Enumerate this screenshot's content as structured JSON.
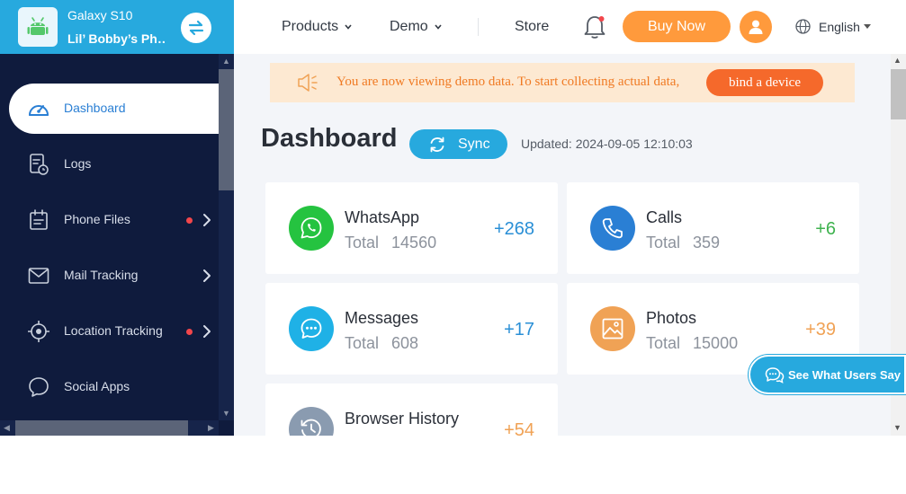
{
  "device": {
    "model": "Galaxy S10",
    "name": "Lil’ Bobby’s Ph…"
  },
  "sidebar": {
    "items": [
      {
        "label": "Dashboard",
        "icon": "dashboard-gauge-icon",
        "active": true,
        "dot": false,
        "chevron": false
      },
      {
        "label": "Logs",
        "icon": "logs-clock-icon",
        "active": false,
        "dot": false,
        "chevron": false
      },
      {
        "label": "Phone Files",
        "icon": "phone-files-calendar-icon",
        "active": false,
        "dot": true,
        "chevron": true
      },
      {
        "label": "Mail Tracking",
        "icon": "mail-envelope-icon",
        "active": false,
        "dot": false,
        "chevron": true
      },
      {
        "label": "Location Tracking",
        "icon": "location-crosshair-icon",
        "active": false,
        "dot": true,
        "chevron": true
      },
      {
        "label": "Social Apps",
        "icon": "social-chat-bubble-icon",
        "active": false,
        "dot": false,
        "chevron": false
      }
    ]
  },
  "topbar": {
    "products_label": "Products",
    "demo_label": "Demo",
    "store_label": "Store",
    "buy_label": "Buy Now",
    "language_label": "English"
  },
  "banner": {
    "text": "You are now viewing demo data. To start collecting actual data,",
    "button_label": "bind a device"
  },
  "main": {
    "title": "Dashboard",
    "sync_label": "Sync",
    "updated_text": "Updated: 2024-09-05 12:10:03",
    "total_label": "Total"
  },
  "cards": [
    {
      "title": "WhatsApp",
      "total": "14560",
      "delta": "+268",
      "icon": "whatsapp-icon",
      "icon_bg": "#25c340",
      "delta_color": "#2a8fd6"
    },
    {
      "title": "Calls",
      "total": "359",
      "delta": "+6",
      "icon": "phone-call-icon",
      "icon_bg": "#2a7fd4",
      "delta_color": "#3fb34f"
    },
    {
      "title": "Messages",
      "total": "608",
      "delta": "+17",
      "icon": "message-bubble-icon",
      "icon_bg": "#1fb1e6",
      "delta_color": "#2a8fd6"
    },
    {
      "title": "Photos",
      "total": "15000",
      "delta": "+39",
      "icon": "photo-image-icon",
      "icon_bg": "#f0a255",
      "delta_color": "#f0a255"
    },
    {
      "title": "Browser History",
      "total": "",
      "delta": "+54",
      "icon": "browser-history-icon",
      "icon_bg": "#8a9bb0",
      "delta_color": "#f0a255"
    }
  ],
  "feedback_label": "See What Users Say",
  "colors": {
    "sidebar_bg": "#0f1b3d",
    "brand_blue": "#27a9de",
    "accent_orange": "#ff9a3c",
    "banner_bg": "#fde9d2",
    "bind_button": "#f5692b"
  }
}
